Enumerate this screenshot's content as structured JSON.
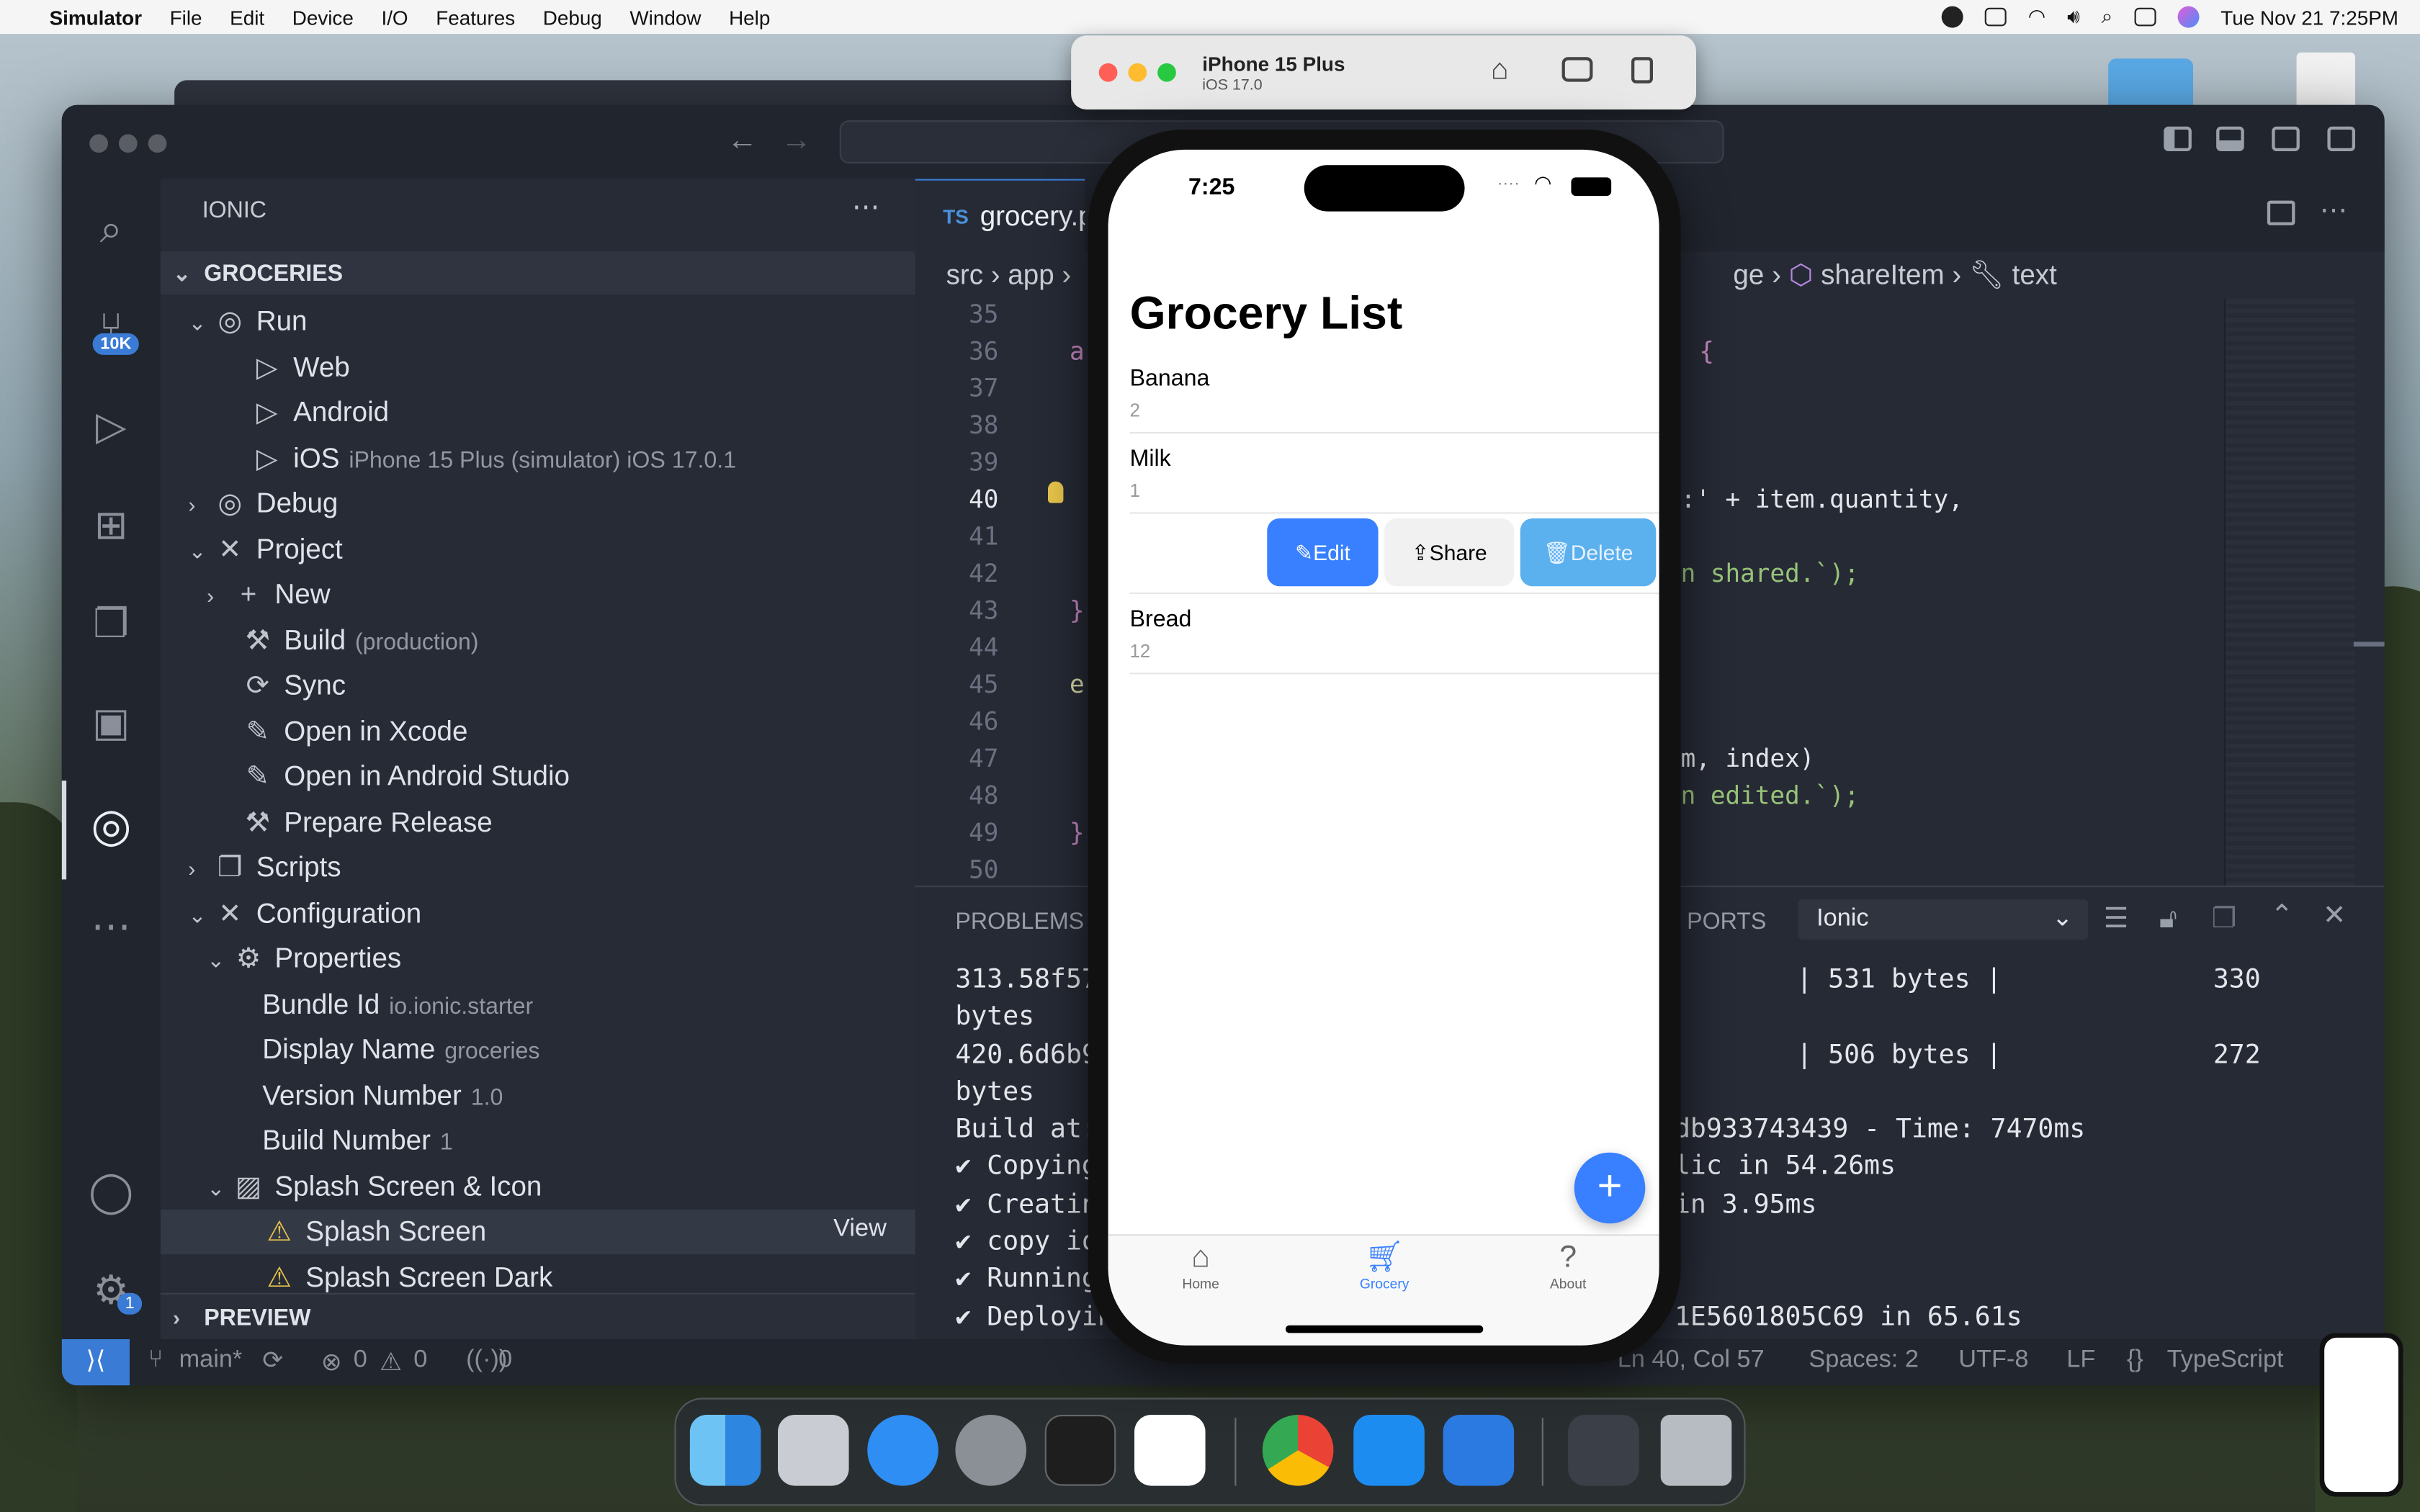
{
  "menubar": {
    "app": "Simulator",
    "menus": [
      "File",
      "Edit",
      "Device",
      "I/O",
      "Features",
      "Debug",
      "Window",
      "Help"
    ],
    "datetime": "Tue Nov 21  7:25PM"
  },
  "simulator": {
    "device": "iPhone 15 Plus",
    "os": "iOS 17.0"
  },
  "vscode": {
    "panel_title": "IONIC",
    "section": "GROCERIES",
    "preview": "PREVIEW",
    "scm_badge": "10K",
    "settings_badge": "1",
    "tree": [
      {
        "label": "Run",
        "sub": ""
      },
      {
        "label": "Web",
        "sub": ""
      },
      {
        "label": "Android",
        "sub": ""
      },
      {
        "label": "iOS",
        "sub": "iPhone 15 Plus (simulator) iOS 17.0.1"
      },
      {
        "label": "Debug",
        "sub": ""
      },
      {
        "label": "Project",
        "sub": ""
      },
      {
        "label": "New",
        "sub": ""
      },
      {
        "label": "Build",
        "sub": "(production)"
      },
      {
        "label": "Sync",
        "sub": ""
      },
      {
        "label": "Open in Xcode",
        "sub": ""
      },
      {
        "label": "Open in Android Studio",
        "sub": ""
      },
      {
        "label": "Prepare Release",
        "sub": ""
      },
      {
        "label": "Scripts",
        "sub": ""
      },
      {
        "label": "Configuration",
        "sub": ""
      },
      {
        "label": "Properties",
        "sub": ""
      },
      {
        "label": "Bundle Id",
        "sub": "io.ionic.starter"
      },
      {
        "label": "Display Name",
        "sub": "groceries"
      },
      {
        "label": "Version Number",
        "sub": "1.0"
      },
      {
        "label": "Build Number",
        "sub": "1"
      },
      {
        "label": "Splash Screen & Icon",
        "sub": ""
      },
      {
        "label": "Splash Screen",
        "sub": ""
      },
      {
        "label": "Splash Screen Dark",
        "sub": ""
      }
    ],
    "view_label": "View",
    "tab": {
      "lang": "TS",
      "file": "grocery.p"
    },
    "breadcrumb": {
      "a": "src",
      "b": "app",
      "c": "ge",
      "d": "shareItem",
      "e": "text"
    },
    "line_numbers": [
      "35",
      "36",
      "37",
      "38",
      "39",
      "40",
      "41",
      "42",
      "43",
      "44",
      "45",
      "46",
      "47",
      "48",
      "49",
      "50"
    ],
    "code": {
      "l36a": "a",
      "l36b": "{",
      "l40": ":' + item.quantity,",
      "l42": "n shared.`);",
      "l43": "}",
      "l45": "e",
      "l47": "m, index)",
      "l48": "n edited.`);",
      "l49": "}"
    },
    "panel": {
      "problems": "PROBLEMS",
      "ports": "PORTS",
      "dropdown": "Ionic",
      "lines": [
        {
          "l": "313.58f57",
          "r": "| 531 bytes |",
          "n": "330"
        },
        {
          "l": "bytes",
          "r": "",
          "n": ""
        },
        {
          "l": "420.6d6b9",
          "r": "| 506 bytes |",
          "n": "272"
        },
        {
          "l": "bytes",
          "r": "",
          "n": ""
        },
        {
          "l": "Build at:",
          "r": "db933743439 - Time: 7470ms",
          "n": ""
        },
        {
          "l": "✔ Copying",
          "r": "lic in 54.26ms",
          "n": ""
        },
        {
          "l": "✔ Creatin",
          "r": "in 3.95ms",
          "n": ""
        },
        {
          "l": "✔ copy io",
          "r": "",
          "n": ""
        },
        {
          "l": "✔ Running",
          "r": "",
          "n": ""
        },
        {
          "l": "✔ Deployin",
          "r": "1E5601805C69 in 65.61s",
          "n": ""
        }
      ]
    },
    "status": {
      "branch": "main*",
      "errors": "0",
      "warnings": "0",
      "ports": "0",
      "pos": "Ln 40, Col 57",
      "spaces": "Spaces: 2",
      "enc": "UTF-8",
      "eol": "LF",
      "lang": "TypeScript"
    }
  },
  "phone": {
    "time": "7:25",
    "title": "Grocery List",
    "items": [
      {
        "name": "Banana",
        "qty": "2"
      },
      {
        "name": "Milk",
        "qty": "1"
      },
      {
        "name": "Bread",
        "qty": "12"
      }
    ],
    "actions": {
      "edit": "Edit",
      "share": "Share",
      "delete": "Delete"
    },
    "fab": "+",
    "tabs": [
      {
        "label": "Home",
        "icon": "home-icon"
      },
      {
        "label": "Grocery",
        "icon": "cart-icon"
      },
      {
        "label": "About",
        "icon": "question-icon"
      }
    ],
    "colors": {
      "primary": "#3880ff",
      "delete": "#5bb0ee",
      "share_bg": "#f1f1f1"
    }
  }
}
